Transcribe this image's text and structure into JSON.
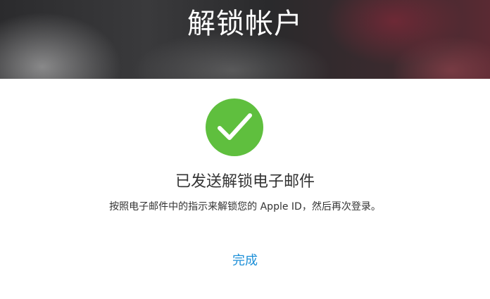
{
  "header": {
    "title": "解锁帐户"
  },
  "status": {
    "icon": "checkmark-circle-icon",
    "icon_color": "#5fbf3e",
    "heading": "已发送解锁电子邮件",
    "description": "按照电子邮件中的指示来解锁您的 Apple ID，然后再次登录。"
  },
  "actions": {
    "done_label": "完成",
    "link_color": "#1e90d8"
  }
}
